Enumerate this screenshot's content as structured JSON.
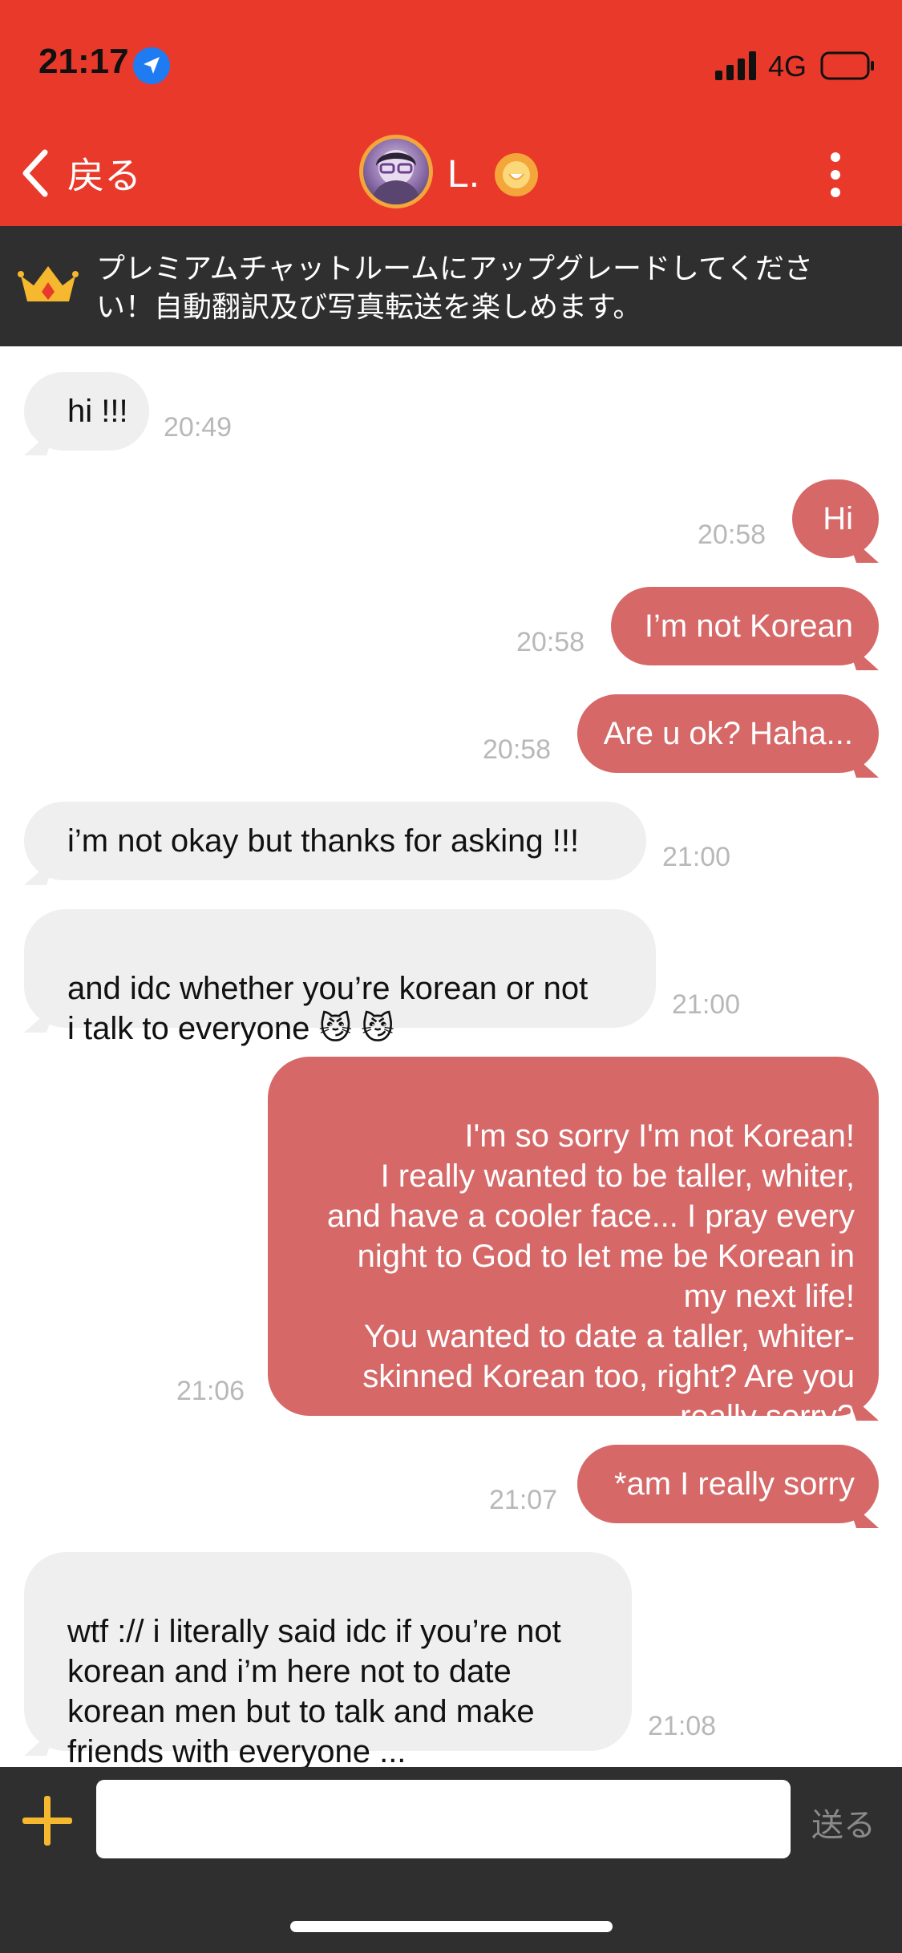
{
  "status_bar": {
    "time": "21:17",
    "network": "4G"
  },
  "header": {
    "back_label": "戻る",
    "contact_name": "L."
  },
  "promo": {
    "text": "プレミアムチャットルームにアップグレードしてください！自動翻訳及び写真転送を楽しめます。"
  },
  "messages": [
    {
      "dir": "in",
      "text": "hi !!!",
      "time": "20:49"
    },
    {
      "dir": "out",
      "text": "Hi",
      "time": "20:58"
    },
    {
      "dir": "out",
      "text": "I’m not Korean",
      "time": "20:58"
    },
    {
      "dir": "out",
      "text": "Are u ok? Haha...",
      "time": "20:58"
    },
    {
      "dir": "in",
      "text": "i’m not okay but thanks for asking !!!",
      "time": "21:00"
    },
    {
      "dir": "in",
      "text": "and idc whether you’re korean or not\ni talk to everyone 😼 😼",
      "time": "21:00"
    },
    {
      "dir": "out",
      "text": "I'm so sorry I'm not Korean!\nI really wanted to be taller, whiter,\nand have a cooler face... I pray every\nnight to God to let me be Korean in\nmy next life!\nYou wanted to date a taller, whiter-\nskinned Korean too, right? Are you\nreally sorry?",
      "time": "21:06"
    },
    {
      "dir": "out",
      "text": "*am I really sorry",
      "time": "21:07"
    },
    {
      "dir": "in",
      "text": "wtf :// i literally said idc if you’re not\nkorean and i’m here not to date\nkorean men but to talk and make\nfriends with everyone ...",
      "time": "21:08"
    }
  ],
  "input": {
    "placeholder": "",
    "value": "",
    "send_label": "送る"
  },
  "colors": {
    "header": "#e8392a",
    "dark_bar": "#2f2f2f",
    "outgoing_bubble": "#d66868",
    "incoming_bubble": "#efefef",
    "accent": "#f5b82e"
  },
  "icons": {
    "location": "location-arrow-icon",
    "signal": "signal-bars-icon",
    "battery": "battery-icon",
    "back": "chevron-left-icon",
    "badge": "smile-badge-icon",
    "more": "vertical-dots-icon",
    "crown": "crown-icon",
    "plus": "plus-icon"
  }
}
